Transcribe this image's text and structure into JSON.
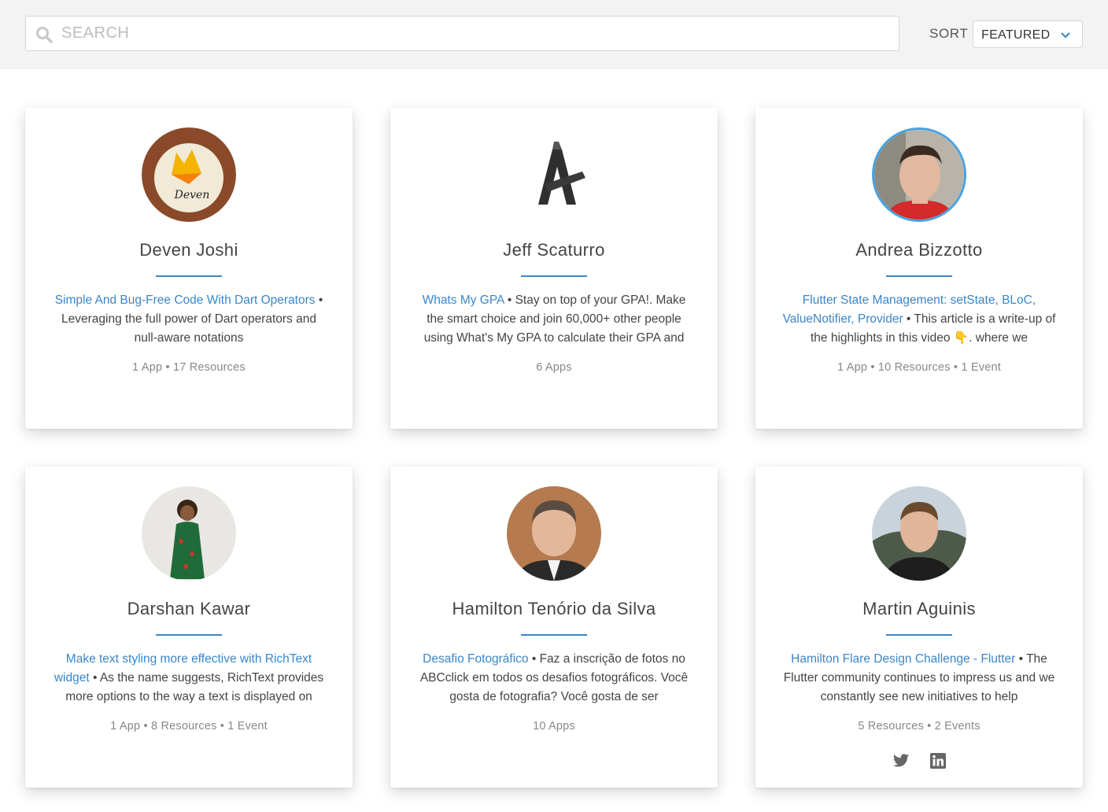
{
  "search": {
    "placeholder": "SEARCH",
    "value": ""
  },
  "sort": {
    "label": "SORT",
    "value": "FEATURED"
  },
  "colors": {
    "link": "#3a86c8",
    "divider": "#3d86c4",
    "ring": "#4aa3df"
  },
  "cards": [
    {
      "name": "Deven Joshi",
      "avatar_icon": "firebase-badge-avatar",
      "link": "Simple And Bug-Free Code With Dart Operators",
      "sep": " • ",
      "text": "Leveraging the full power of Dart operators and null-aware notations",
      "stats": "1 App • 17 Resources"
    },
    {
      "name": "Jeff Scaturro",
      "avatar_icon": "a-logo-avatar",
      "link": "Whats My GPA",
      "sep": " • ",
      "text": "Stay on top of your GPA!. Make the smart choice and join 60,000+ other people using What's My GPA to calculate their GPA and",
      "stats": "6 Apps"
    },
    {
      "name": "Andrea Bizzotto",
      "avatar_icon": "person-avatar",
      "link": "Flutter State Management: setState, BLoC, ValueNotifier, Provider",
      "sep": " • ",
      "text": "This article is a write-up of the highlights in this video 👇. where we",
      "stats": "1 App • 10 Resources • 1 Event"
    },
    {
      "name": "Darshan Kawar",
      "avatar_icon": "child-avatar",
      "link": "Make text styling more effective with RichText widget",
      "sep": " • ",
      "text": "As the name suggests, RichText provides more options to the way a text is displayed on",
      "stats": "1 App • 8 Resources • 1 Event"
    },
    {
      "name": "Hamilton Tenório da Silva",
      "avatar_icon": "person-avatar",
      "link": "Desafio Fotográfico",
      "sep": " • ",
      "text": "Faz a inscrição de fotos no ABCclick em todos os desafios fotográficos. Você gosta de fotografia? Você gosta de ser",
      "stats": "10 Apps"
    },
    {
      "name": "Martin Aguinis",
      "avatar_icon": "person-avatar",
      "link": "Hamilton Flare Design Challenge - Flutter",
      "sep": " • ",
      "text": "The Flutter community continues to impress us and we constantly see new initiatives to help",
      "stats": "5 Resources • 2 Events",
      "social": [
        "twitter-icon",
        "linkedin-icon"
      ]
    }
  ]
}
